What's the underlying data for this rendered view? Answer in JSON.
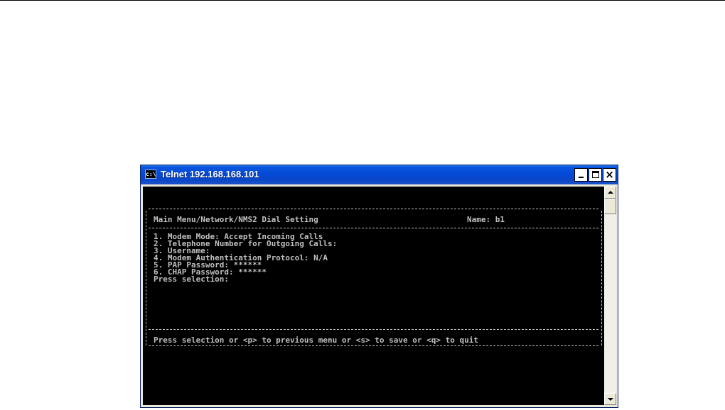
{
  "window": {
    "icon": "console-icon",
    "title": "Telnet 192.168.168.101"
  },
  "terminal": {
    "menu_path": "Main Menu/Network/NMS2 Dial Setting",
    "name_field": "Name: b1",
    "items": [
      "1. Modem Mode: Accept Incoming Calls",
      "2. Telephone Number for Outgoing Calls:",
      "3. Username:",
      "4. Modem Authentication Protocol: N/A",
      "5. PAP Password: ******",
      "6. CHAP Password: ******"
    ],
    "prompt": "Press selection:",
    "footer": "Press selection or <p> to previous menu or <s> to save or <q> to quit"
  },
  "colors": {
    "terminal_bg": "#000000",
    "terminal_fg": "#c0c0c0",
    "titlebar": "#0349d6"
  }
}
